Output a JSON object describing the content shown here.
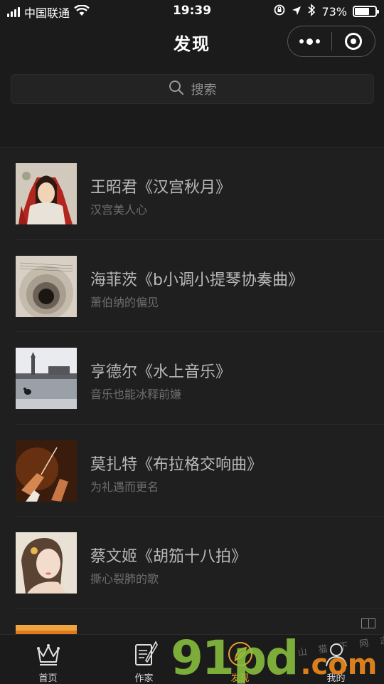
{
  "status_bar": {
    "carrier": "中国联通",
    "time": "19:39",
    "battery": "73%",
    "battery_level": 0.73
  },
  "header": {
    "title": "发现"
  },
  "search": {
    "placeholder": "搜索"
  },
  "items": [
    {
      "title": "王昭君《汉宫秋月》",
      "subtitle": "汉宫美人心",
      "thumb": "portrait-painting"
    },
    {
      "title": "海菲茨《b小调小提琴协奏曲》",
      "subtitle": "萧伯纳的偏见",
      "thumb": "sheet-music-spiral"
    },
    {
      "title": "亨德尔《水上音乐》",
      "subtitle": "音乐也能冰释前嫌",
      "thumb": "river-clock-tower"
    },
    {
      "title": "莫扎特《布拉格交响曲》",
      "subtitle": "为礼遇而更名",
      "thumb": "conductor-hands"
    },
    {
      "title": "蔡文姬《胡笳十八拍》",
      "subtitle": "撕心裂肺的歌",
      "thumb": "woman-portrait"
    }
  ],
  "tabs": [
    {
      "label": "首页",
      "icon": "crown-icon"
    },
    {
      "label": "作家",
      "icon": "quill-document-icon"
    },
    {
      "label": "发现",
      "icon": "feather-icon"
    },
    {
      "label": "我的",
      "icon": "user-icon"
    }
  ],
  "watermark": {
    "number": "91",
    "letters": "pd",
    "domain": ".com",
    "text": "山 猫 下 网 志"
  },
  "colors": {
    "background": "#1b1b1b",
    "active_tab": "#e6a02c"
  }
}
